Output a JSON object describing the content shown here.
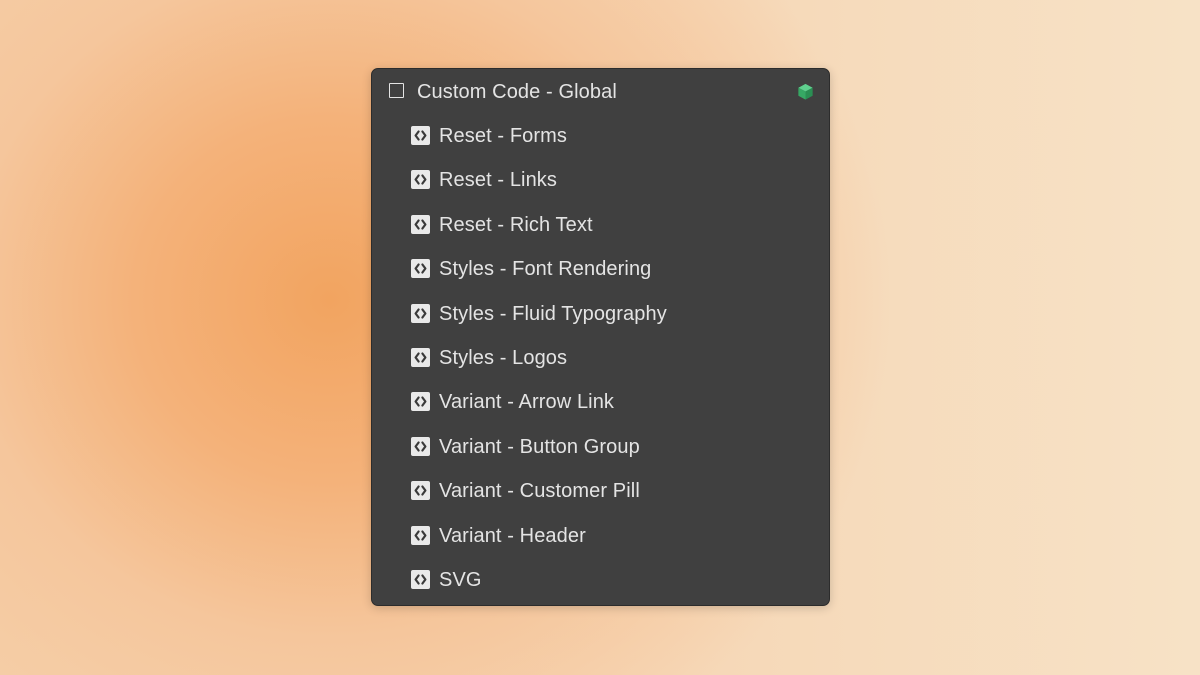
{
  "panel": {
    "root": {
      "label": "Custom Code - Global",
      "checked": false,
      "status_icon": "cube-icon",
      "status_color": "#3fb573"
    },
    "items": [
      {
        "label": "Reset - Forms",
        "icon": "code-icon"
      },
      {
        "label": "Reset - Links",
        "icon": "code-icon"
      },
      {
        "label": "Reset - Rich Text",
        "icon": "code-icon"
      },
      {
        "label": "Styles - Font Rendering",
        "icon": "code-icon"
      },
      {
        "label": "Styles - Fluid Typography",
        "icon": "code-icon"
      },
      {
        "label": "Styles - Logos",
        "icon": "code-icon"
      },
      {
        "label": "Variant - Arrow Link",
        "icon": "code-icon"
      },
      {
        "label": "Variant - Button Group",
        "icon": "code-icon"
      },
      {
        "label": "Variant - Customer Pill",
        "icon": "code-icon"
      },
      {
        "label": "Variant - Header",
        "icon": "code-icon"
      },
      {
        "label": "SVG",
        "icon": "code-icon"
      }
    ]
  },
  "colors": {
    "panel_background": "#404040",
    "text": "#e4e4e4",
    "accent_green": "#3fb573",
    "background_orange": "#f2a460"
  }
}
